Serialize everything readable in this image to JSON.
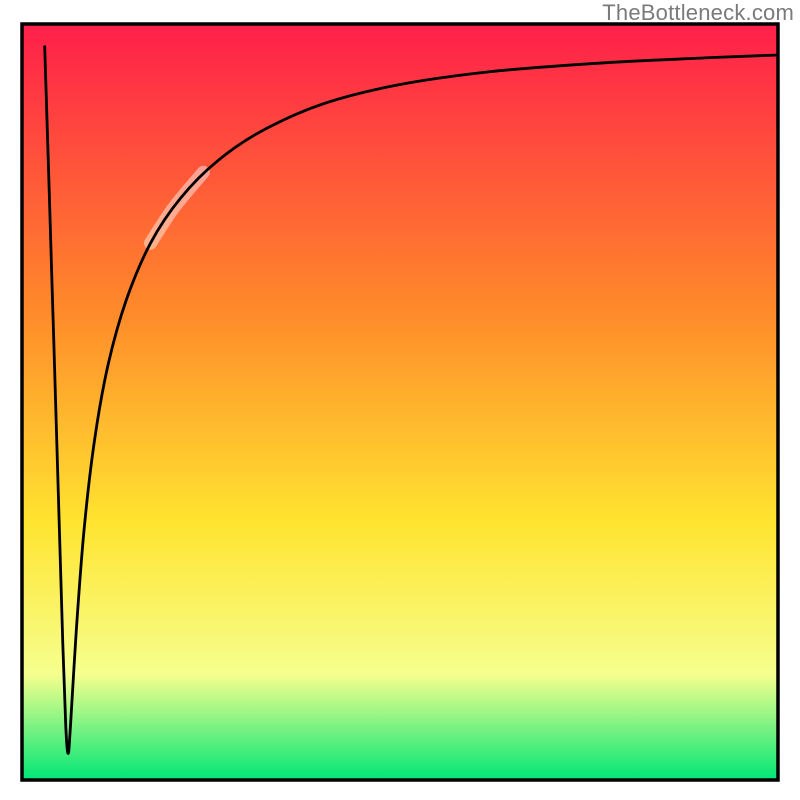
{
  "watermark": "TheBottleneck.com",
  "colors": {
    "gradient_top": "#ff1f4a",
    "gradient_mid1": "#ff8a2a",
    "gradient_mid2": "#ffe430",
    "gradient_mid3": "#f6ff8e",
    "gradient_bottom": "#00e676",
    "frame": "#000000",
    "curve": "#000000",
    "highlight": "rgba(255,255,255,0.45)"
  },
  "chart_data": {
    "type": "line",
    "title": "",
    "xlabel": "",
    "ylabel": "",
    "xlim": [
      0,
      100
    ],
    "ylim": [
      0,
      100
    ],
    "notes": "Curve derived from a very sharp V-shaped dip near the left edge followed by an inverse-like rise that levels off near the top. Values are percentages of the visible plot area. A short pale/translucent segment highlights the curve in the mid-rise region.",
    "series": [
      {
        "name": "curve",
        "points": [
          {
            "x": 3.0,
            "y": 97.0
          },
          {
            "x": 3.6,
            "y": 78.0
          },
          {
            "x": 4.2,
            "y": 58.0
          },
          {
            "x": 4.8,
            "y": 38.0
          },
          {
            "x": 5.4,
            "y": 18.0
          },
          {
            "x": 5.8,
            "y": 7.0
          },
          {
            "x": 6.1,
            "y": 3.5
          },
          {
            "x": 6.4,
            "y": 7.0
          },
          {
            "x": 7.2,
            "y": 20.0
          },
          {
            "x": 8.2,
            "y": 33.0
          },
          {
            "x": 9.6,
            "y": 45.0
          },
          {
            "x": 11.4,
            "y": 55.0
          },
          {
            "x": 13.8,
            "y": 63.5
          },
          {
            "x": 17.0,
            "y": 71.0
          },
          {
            "x": 21.0,
            "y": 77.0
          },
          {
            "x": 26.0,
            "y": 82.0
          },
          {
            "x": 32.0,
            "y": 86.0
          },
          {
            "x": 40.0,
            "y": 89.5
          },
          {
            "x": 50.0,
            "y": 92.0
          },
          {
            "x": 62.0,
            "y": 93.7
          },
          {
            "x": 76.0,
            "y": 94.8
          },
          {
            "x": 90.0,
            "y": 95.5
          },
          {
            "x": 100.0,
            "y": 95.9
          }
        ]
      },
      {
        "name": "highlight_segment",
        "points": [
          {
            "x": 17.0,
            "y": 71.0
          },
          {
            "x": 20.0,
            "y": 75.6
          },
          {
            "x": 24.0,
            "y": 80.4
          }
        ]
      }
    ]
  }
}
